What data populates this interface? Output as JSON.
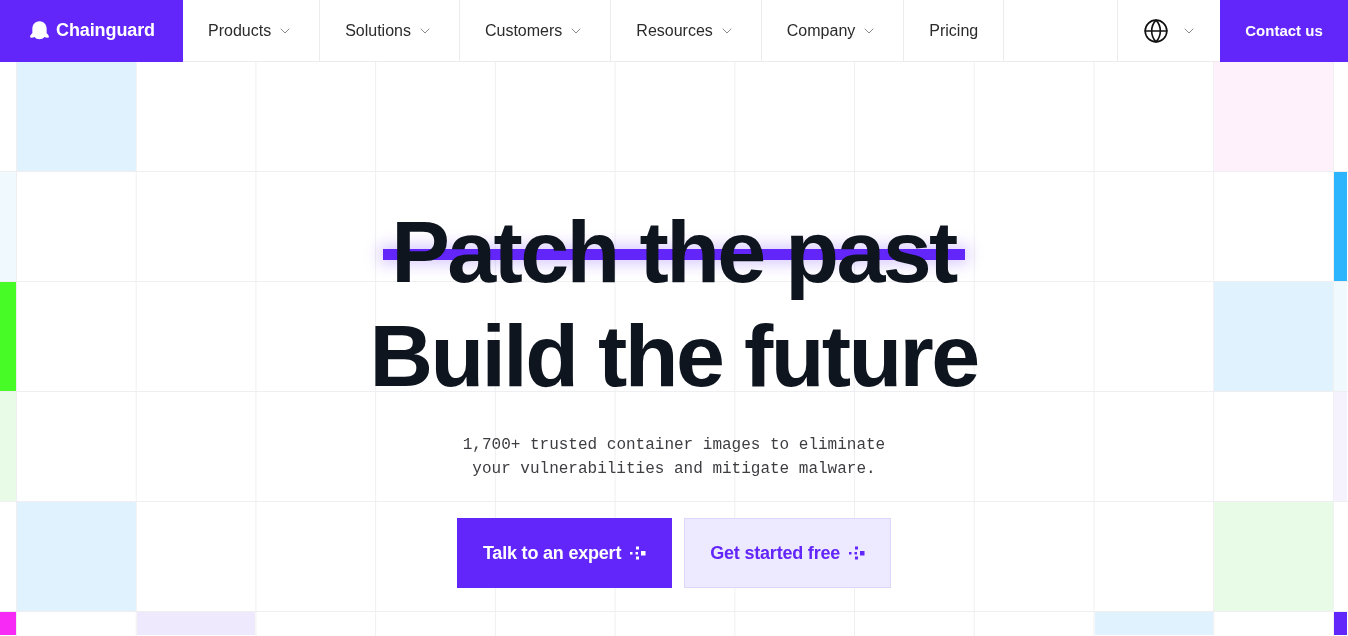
{
  "nav": {
    "logo": {
      "text": "Chainguard"
    },
    "items": [
      {
        "label": "Products",
        "dropdown": true
      },
      {
        "label": "Solutions",
        "dropdown": true
      },
      {
        "label": "Customers",
        "dropdown": true
      },
      {
        "label": "Resources",
        "dropdown": true
      },
      {
        "label": "Company",
        "dropdown": true
      },
      {
        "label": "Pricing",
        "dropdown": false
      }
    ],
    "cta": {
      "label": "Contact us"
    }
  },
  "hero": {
    "headline": [
      {
        "text": "Patch the past",
        "struck": true
      },
      {
        "text": "Build the future",
        "struck": false
      }
    ],
    "subtitle": "1,700+ trusted container images to eliminate your vulnerabilities and mitigate malware.",
    "buttons": [
      {
        "label": "Talk to an expert",
        "kind": "primary"
      },
      {
        "label": "Get started free",
        "kind": "secondary"
      }
    ]
  }
}
